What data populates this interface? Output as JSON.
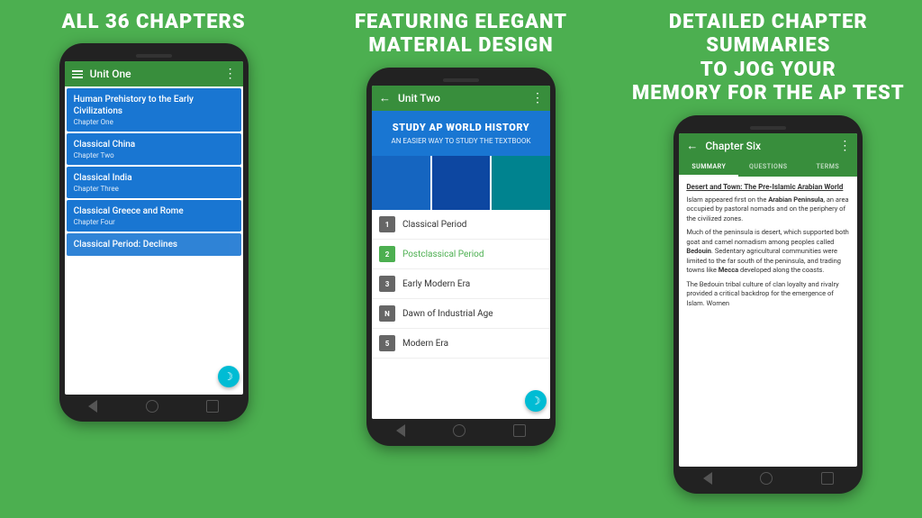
{
  "panel1": {
    "title": "ALL 36 CHAPTERS",
    "appbar": {
      "title": "Unit One"
    },
    "chapters": [
      {
        "title": "Human Prehistory to the Early Civilizations",
        "sub": "Chapter One"
      },
      {
        "title": "Classical China",
        "sub": "Chapter Two"
      },
      {
        "title": "Classical India",
        "sub": "Chapter Three"
      },
      {
        "title": "Classical Greece and Rome",
        "sub": "Chapter Four"
      },
      {
        "title": "Classical Period: Declines",
        "sub": ""
      }
    ]
  },
  "panel2": {
    "title": "FEATURING ELEGANT MATERIAL DESIGN",
    "appbar": {
      "title": "Unit Two"
    },
    "banner": {
      "title": "STUDY AP WORLD HISTORY",
      "subtitle": "AN EASIER WAY TO STUDY THE TEXTBOOK"
    },
    "units": [
      {
        "num": "1",
        "name": "Classical Period",
        "active": false
      },
      {
        "num": "2",
        "name": "Postclassical Period",
        "active": true
      },
      {
        "num": "3",
        "name": "Early Modern Era",
        "active": false
      },
      {
        "num": "N",
        "name": "Dawn of Industrial Age",
        "active": false
      },
      {
        "num": "5",
        "name": "Modern Era",
        "active": false
      }
    ]
  },
  "panel3": {
    "title": "DETAILED CHAPTER SUMMARIES To Jog Your MEMORY FOR THE AP TEST",
    "appbar": {
      "title": "Chapter Six"
    },
    "tabs": [
      {
        "label": "SUMMARY",
        "active": true
      },
      {
        "label": "QUESTIONS",
        "active": false
      },
      {
        "label": "TERMS",
        "active": false
      }
    ],
    "summary": {
      "section_title": "Desert and Town: The Pre-Islamic Arabian World",
      "paragraphs": [
        "Islam appeared first on the Arabian Peninsula, an area occupied by pastoral nomads and on the periphery of the civilized zones.",
        "Much of the peninsula is desert, which supported both goat and camel nomadism among peoples called Bedouin. Sedentary agricultural communities were limited to the far south of the peninsula, and trading towns like Mecca developed along the coasts.",
        "The Bedouin tribal culture of clan loyalty and rivalry provided a critical backdrop for the emergence of Islam. Women"
      ],
      "bold_words": [
        "Arabian Peninsula",
        "Bedouin",
        "Mecca"
      ]
    }
  },
  "nav": {
    "back": "←",
    "dots": "⋮"
  }
}
